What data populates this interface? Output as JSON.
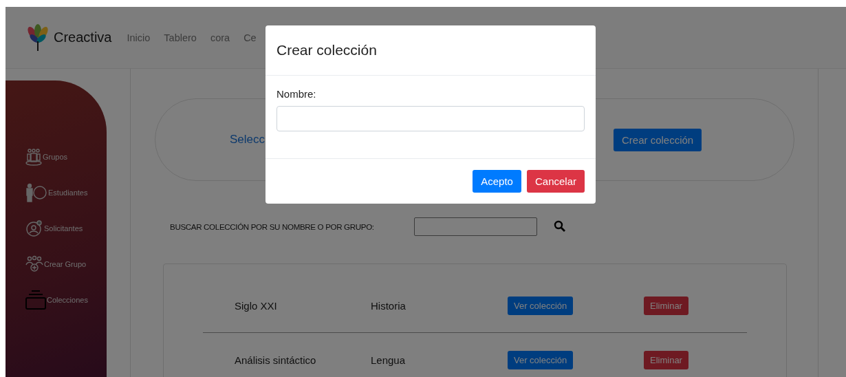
{
  "brand": {
    "name": "Creactiva"
  },
  "nav": [
    {
      "label": "Inicio"
    },
    {
      "label": "Tablero"
    },
    {
      "label": "cora"
    },
    {
      "label": "Ce"
    }
  ],
  "sidebar": {
    "items": [
      {
        "label": "Grupos",
        "kind": "groups"
      },
      {
        "label": "Estudiantes",
        "kind": "student"
      },
      {
        "label": "Solicitantes",
        "kind": "applicant"
      },
      {
        "label": "Crear Grupo",
        "kind": "add-group"
      },
      {
        "label": "Colecciones",
        "kind": "collections"
      }
    ]
  },
  "banner": {
    "text": "Selecc",
    "button": "Crear colección"
  },
  "search": {
    "label": "BUSCAR COLECCIÓN POR SU NOMBRE O POR GRUPO:"
  },
  "collections": [
    {
      "name": "Siglo XXI",
      "group": "Historia",
      "view": "Ver colección",
      "delete": "Eliminar"
    },
    {
      "name": "Análisis sintáctico",
      "group": "Lengua",
      "view": "Ver colección",
      "delete": "Eliminar"
    }
  ],
  "modal": {
    "title": "Crear colección",
    "field_label": "Nombre:",
    "buttons": [
      {
        "label": "Acepto",
        "kind": "primary"
      },
      {
        "label": "Cancelar",
        "kind": "danger"
      }
    ]
  }
}
